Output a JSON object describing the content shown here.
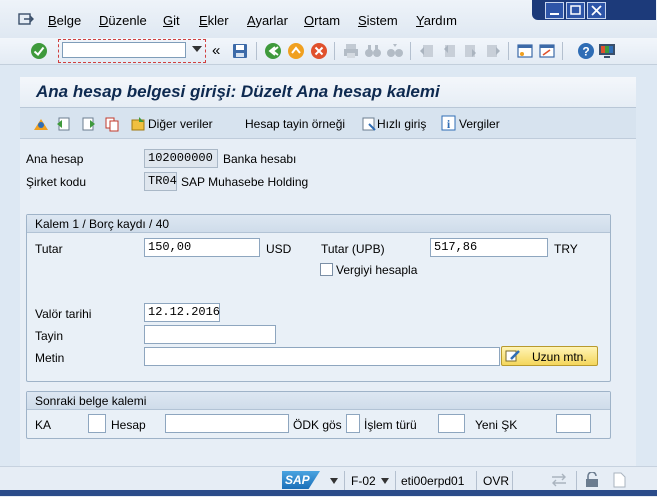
{
  "menu": {
    "items": [
      "Belge",
      "Düzenle",
      "Git",
      "Ekler",
      "Ayarlar",
      "Ortam",
      "Sistem",
      "Yardım"
    ],
    "mnemonics": [
      "B",
      "D",
      "G",
      "E",
      "A",
      "O",
      "S",
      "Y"
    ]
  },
  "toolbar": {
    "command_value": "",
    "back_double": "«"
  },
  "title": "Ana hesap belgesi girişi: Düzelt Ana hesap kalemi",
  "app_toolbar": {
    "other_data": "Diğer veriler",
    "account_template": "Hesap tayin örneği",
    "fast_entry": "Hızlı giriş",
    "taxes": "Vergiler"
  },
  "header": {
    "gl_account_label": "Ana hesap",
    "gl_account_value": "102000000",
    "gl_account_desc": "Banka hesabı",
    "company_label": "Şirket kodu",
    "company_value": "TR04",
    "company_desc": "SAP Muhasebe Holding"
  },
  "item_group": {
    "title": "Kalem 1 / Borç kaydı / 40",
    "amount_label": "Tutar",
    "amount_value": "150,00",
    "amount_currency": "USD",
    "amount_local_label": "Tutar (UPB)",
    "amount_local_value": "517,86",
    "local_currency": "TRY",
    "calc_tax_label": "Vergiyi hesapla",
    "calc_tax_checked": false,
    "value_date_label": "Valör tarihi",
    "value_date_value": "12.12.2016",
    "assignment_label": "Tayin",
    "assignment_value": "",
    "text_label": "Metin",
    "text_value": "",
    "long_text_button": "Uzun mtn."
  },
  "next_item_group": {
    "title": "Sonraki belge kalemi",
    "posting_key_label": "KA",
    "account_label": "Hesap",
    "special_gl_label": "ÖDK gös",
    "transaction_type_label": "İşlem türü",
    "new_company_label": "Yeni ŞK"
  },
  "statusbar": {
    "logo": "SAP",
    "tcode": "F-02",
    "server": "eti00erpd01",
    "mode": "OVR"
  },
  "colors": {
    "title": "#0e2a50",
    "window_controls": "#1c3a7a",
    "button_yellow": "#f4d65c"
  }
}
